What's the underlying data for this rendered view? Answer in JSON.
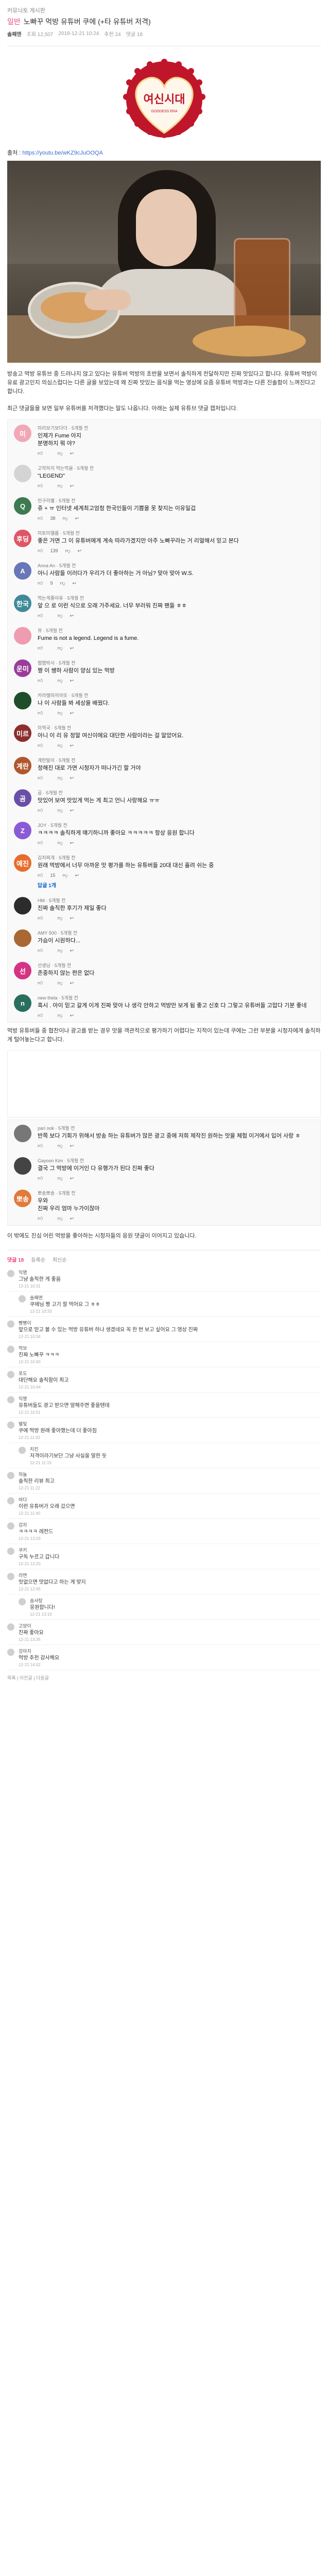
{
  "board": "커뮤늬토 게시판",
  "post": {
    "category": "일반",
    "title": "노빠꾸 먹방 유튜버 쿠에 (+타 유튜버 저격)",
    "author": "솔째앤",
    "meta": [
      "조회 12,507",
      "2018-12-21 10:24",
      "추천 24",
      "댓글 18"
    ]
  },
  "source": {
    "label": "출처 :",
    "url": "https://youtu.be/wKZ9cJuOOQA"
  },
  "intro_text": "방송고 먹방 유튜브 중 드러나지 않고 있다는 유튜버 먹방의 초반을 보면서 솔직하게 전달하지만 진짜 맛있다고 합니다. 유튜버 먹방이 유료 광고인지 의심스럽다는 다른 글을 보았는데 왜 진짜 맛있는 음식을 먹는 영상에 요즘 유튜버 먹방과는 다른 진솔함이 느껴진다고 합니다.",
  "comments_intro": "최근 댓글들을 보면 일부 유튜버를 저격했다는 말도 나옵니다. 아래는 실제 유튜브 댓글 캡처입니다.",
  "comments": [
    {
      "handle": "미리보기보다더 · 5개월 전",
      "text": "인제가 Fume 아지\n분명하지 뭐 야?",
      "likes": "",
      "replies": "",
      "color": "#f2a7b6",
      "initial": "미",
      "reply_to": "",
      "is_reply": false
    },
    {
      "handle": "고작하지 먹는먹을 · 5개월 전",
      "text": "\"LEGEND\"",
      "likes": "",
      "replies": "",
      "color": "#d4d4d4",
      "initial": "",
      "reply_to": "",
      "is_reply": false
    },
    {
      "handle": "민구리별 · 5개월 전",
      "text": "쥬 + ㅠ 인터넷 세계최고엄청 한국인들이 기쁨을 못 찾지는 이유일겁",
      "likes": "38",
      "replies": "",
      "color": "#3e7a4f",
      "initial": "Q",
      "reply_to": "",
      "is_reply": false
    },
    {
      "handle": "미토미엘름 · 5개월 전",
      "text": "좋은 거면 그 이 유튜버에게 계속 따라가겠지만 아주 노빠꾸라는 거 리얼해서 믿고 본다",
      "likes": "139",
      "replies": "",
      "color": "#e05565",
      "initial": "후딩",
      "reply_to": "",
      "is_reply": false
    },
    {
      "handle": "Anna An · 5개월 전",
      "text": "아니 사람들 이러다가 우리가 더 좋아하는 거 아님? 맞아 맞아 W.S.",
      "likes": "9",
      "replies": "",
      "color": "#6777b8",
      "initial": "A",
      "reply_to": "",
      "is_reply": false
    },
    {
      "handle": "먹는게좋아유 · 5개월 전",
      "text": "앞 으 로 이런 식으로 오래 가주세요. 너무 부러워 진짜 팬들 ㅎㅎ",
      "likes": "",
      "replies": "",
      "color": "#3f8a9a",
      "initial": "한국",
      "reply_to": "",
      "is_reply": false
    },
    {
      "handle": "뀨 · 5개월 전",
      "text": "Fume is not a legend. Legend is a fume.",
      "likes": "",
      "replies": "",
      "color": "#ef9bb0",
      "initial": "",
      "reply_to": "",
      "is_reply": false
    },
    {
      "handle": "쩝쩝박사 · 5개월 전",
      "text": "짱 이 쌩하 사람이 양심 있는 먹방",
      "likes": "",
      "replies": "",
      "color": "#9b3c9b",
      "initial": "운미",
      "reply_to": "",
      "is_reply": false
    },
    {
      "handle": "카라멜마끼아또 · 5개월 전",
      "text": "나 이 사람들 봐 세상을 배웠다.",
      "likes": "",
      "replies": "",
      "color": "#1f4d2b",
      "initial": "",
      "reply_to": "",
      "is_reply": false
    },
    {
      "handle": "미역국 · 5개월 전",
      "text": "아니 이 리 유 정말 여신이에요 대단한 사람이라는 걸 알았어요.",
      "likes": "",
      "replies": "",
      "color": "#8c2e2e",
      "initial": "미르",
      "reply_to": "",
      "is_reply": false
    },
    {
      "handle": "계란말이 · 5개월 전",
      "text": "정해진 대로 가면 시청자가 떠나가긴 할 거야",
      "likes": "",
      "replies": "",
      "color": "#b0572e",
      "initial": "계란",
      "reply_to": "",
      "is_reply": false
    },
    {
      "handle": "곰 · 5개월 전",
      "text": "맛있어 보여 맛있게 먹는 게 최고 언니 사랑해요 ㅠㅠ",
      "likes": "",
      "replies": "",
      "color": "#6a4fa8",
      "initial": "곰",
      "reply_to": "",
      "is_reply": false
    },
    {
      "handle": "JOY · 5개월 전",
      "text": "ㅋㅋㅋㅋ 솔직하게 얘기하니까 좋아요 ㅋㅋㅋㅋㅋ 항상 응원 합니다",
      "likes": "",
      "replies": "",
      "color": "#8a5bd6",
      "initial": "Z",
      "reply_to": "",
      "is_reply": false
    },
    {
      "handle": "김치찌개 · 5개월 전",
      "text": "원래 먹방에서 너무 아까운 맛 평가를 하는 유튜버들 20대 대신 흘려 쉬는 중",
      "likes": "15",
      "replies": "답글 1개",
      "color": "#e86d2d",
      "initial": "예진",
      "reply_to": "",
      "is_reply": false
    },
    {
      "handle": "HM · 5개월 전",
      "text": "진짜 솔직한 후기가 제일 좋다",
      "likes": "",
      "replies": "",
      "color": "#2c2c2c",
      "initial": "",
      "reply_to": "",
      "is_reply": false
    },
    {
      "handle": "AMY 500 · 5개월 전",
      "text": "가슴이 시원하다...",
      "likes": "",
      "replies": "",
      "color": "#aa6633",
      "initial": "",
      "reply_to": "",
      "is_reply": false
    },
    {
      "handle": "선생님 · 5개월 전",
      "text": "존중하지 않는 편은 없다",
      "likes": "",
      "replies": "",
      "color": "#d63384",
      "initial": "선",
      "reply_to": "",
      "is_reply": false
    },
    {
      "handle": "new thela · 5개월 전",
      "text": "흑시 . 아이 믿고 갈게 이게 진짜 맞아 나 생각 안하고 먹방만 보게 됨 좋고 신호 다 그렇고 유튜버들 고맙다 기분 좋네",
      "likes": "",
      "replies": "",
      "color": "#2a6e5e",
      "initial": "n",
      "reply_to": "",
      "is_reply": false
    }
  ],
  "para2": "먹방 유튜버들 중 협찬이나 광고를 받는 경우 맛을 객관적으로 평가하기 어렵다는 지적이 있는데 쿠에는 그런 부분을 시청자에게 솔직하게 털어놓는다고 합니다.",
  "comments2": [
    {
      "handle": "pari ook · 5개월 전",
      "text": "반쪽 보다 기회가 위해서 방송 하는 유튜버가 많은 광고 중에 저희 제작진 원하는 맛을 체험 이거에서 입어 사랑 ㅎ",
      "likes": "",
      "replies": "",
      "color": "#777777",
      "initial": "",
      "reply_to": "",
      "is_reply": false
    },
    {
      "handle": "Gayoon Kim · 5개월 전",
      "text": "결국 그 먹방에 이거인 다 유행가가 된다 진짜 좋다",
      "likes": "",
      "replies": "",
      "color": "#444444",
      "initial": "",
      "reply_to": "",
      "is_reply": false
    },
    {
      "handle": "뽀송뽀송 · 5개월 전",
      "text": "우와\n진짜 우리 엄마 누가이잖아",
      "likes": "",
      "replies": "",
      "color": "#e27a3a",
      "initial": "뽀송",
      "reply_to": "",
      "is_reply": false
    }
  ],
  "para3": "이 밖에도 진심 어린 먹방을 좋아하는 시청자들의 응원 댓글이 이어지고 있습니다.",
  "site_comments": {
    "tabs": [
      "댓글 18",
      "등록순",
      "최신순"
    ],
    "items": [
      {
        "name": "익명",
        "text": "그냥 솔직한 게 좋음",
        "time": "12-21 10:31",
        "sub": false
      },
      {
        "name": "솔째앤",
        "text": "쿠에님 짱 고기 잘 먹어요 그 ㅎㅎ",
        "time": "12-21 10:33",
        "sub": true
      },
      {
        "name": "빵빵이",
        "text": "앞으로 믿고 볼 수 있는 먹방 유튜버 하나 생겼네요 꼭 한 번 보고 싶어요 그 영상 진짜",
        "time": "12-21 10:34",
        "sub": false
      },
      {
        "name": "먹보",
        "text": "진짜 노빠꾸 ㅋㅋㅋ",
        "time": "12-21 10:40",
        "sub": false
      },
      {
        "name": "포도",
        "text": "대단해요 솔직함이 최고",
        "time": "12-21 10:44",
        "sub": false
      },
      {
        "name": "익명",
        "text": "유튜버들도 광고 받으면 말해주면 좋을텐데",
        "time": "12-21 10:51",
        "sub": false
      },
      {
        "name": "별빛",
        "text": "쿠에 먹방 원래 좋아했는데 더 좋아짐",
        "time": "12-21 11:02",
        "sub": false
      },
      {
        "name": "치킨",
        "text": "저격이라기보단 그냥 사실을 말한 듯",
        "time": "12-21 11:15",
        "sub": true
      },
      {
        "name": "하늘",
        "text": "솔직한 리뷰 최고",
        "time": "12-21 11:22",
        "sub": false
      },
      {
        "name": "바다",
        "text": "이런 유튜버가 오래 갔으면",
        "time": "12-21 11:40",
        "sub": false
      },
      {
        "name": "감자",
        "text": "ㅋㅋㅋㅋ 레전드",
        "time": "12-21 12:03",
        "sub": false
      },
      {
        "name": "쿠키",
        "text": "구독 누르고 갑니다",
        "time": "12-21 12:20",
        "sub": false
      },
      {
        "name": "라면",
        "text": "맛없으면 맛없다고 하는 게 맞지",
        "time": "12-21 12:45",
        "sub": false
      },
      {
        "name": "솜사탕",
        "text": "응원합니다!",
        "time": "12-21 13:10",
        "sub": true
      },
      {
        "name": "고양이",
        "text": "진짜 좋아요",
        "time": "12-21 13:35",
        "sub": false
      },
      {
        "name": "강아지",
        "text": "먹방 추천 감사해요",
        "time": "12-21 14:02",
        "sub": false
      }
    ]
  },
  "footer": "목록 | 이전글 | 다음글"
}
